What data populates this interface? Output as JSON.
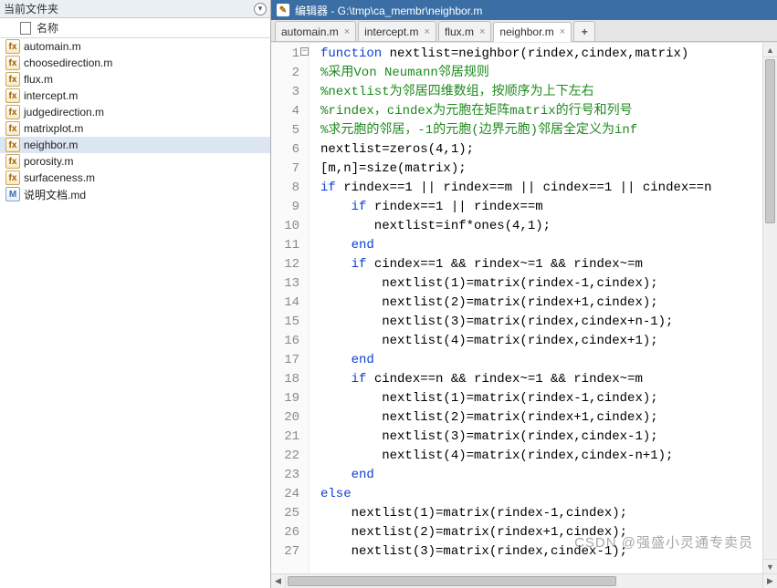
{
  "file_panel": {
    "title": "当前文件夹",
    "column_header": "名称",
    "files": [
      {
        "name": "automain.m",
        "type": "m"
      },
      {
        "name": "choosedirection.m",
        "type": "m"
      },
      {
        "name": "flux.m",
        "type": "m"
      },
      {
        "name": "intercept.m",
        "type": "m"
      },
      {
        "name": "judgedirection.m",
        "type": "m"
      },
      {
        "name": "matrixplot.m",
        "type": "m"
      },
      {
        "name": "neighbor.m",
        "type": "m",
        "selected": true
      },
      {
        "name": "porosity.m",
        "type": "m"
      },
      {
        "name": "surfaceness.m",
        "type": "m"
      },
      {
        "name": "说明文档.md",
        "type": "md"
      }
    ]
  },
  "editor": {
    "title": "编辑器 - G:\\tmp\\ca_membr\\neighbor.m",
    "tabs": [
      {
        "label": "automain.m",
        "active": false
      },
      {
        "label": "intercept.m",
        "active": false
      },
      {
        "label": "flux.m",
        "active": false
      },
      {
        "label": "neighbor.m",
        "active": true
      }
    ],
    "plus_label": "+",
    "lines": [
      {
        "n": 1,
        "fold": true,
        "spans": [
          {
            "c": "kw",
            "t": "function "
          },
          {
            "c": "fn",
            "t": "nextlist=neighbor(rindex,cindex,matrix)"
          }
        ]
      },
      {
        "n": 2,
        "spans": [
          {
            "c": "cm",
            "t": "%采用Von Neumann邻居规则"
          }
        ]
      },
      {
        "n": 3,
        "spans": [
          {
            "c": "cm",
            "t": "%nextlist为邻居四维数组，按顺序为上下左右"
          }
        ]
      },
      {
        "n": 4,
        "spans": [
          {
            "c": "cm",
            "t": "%rindex，cindex为元胞在矩阵matrix的行号和列号"
          }
        ]
      },
      {
        "n": 5,
        "spans": [
          {
            "c": "cm",
            "t": "%求元胞的邻居，-1的元胞(边界元胞)邻居全定义为inf"
          }
        ]
      },
      {
        "n": 6,
        "spans": [
          {
            "c": "fn",
            "t": "nextlist=zeros(4,1);"
          }
        ]
      },
      {
        "n": 7,
        "spans": [
          {
            "c": "fn",
            "t": "[m,n]=size(matrix);"
          }
        ]
      },
      {
        "n": 8,
        "spans": [
          {
            "c": "kw",
            "t": "if "
          },
          {
            "c": "fn",
            "t": "rindex==1 || rindex==m || cindex==1 || cindex==n"
          }
        ]
      },
      {
        "n": 9,
        "spans": [
          {
            "c": "fn",
            "t": "    "
          },
          {
            "c": "kw",
            "t": "if "
          },
          {
            "c": "fn",
            "t": "rindex==1 || rindex==m"
          }
        ]
      },
      {
        "n": 10,
        "spans": [
          {
            "c": "fn",
            "t": "       nextlist=inf*ones(4,1);"
          }
        ]
      },
      {
        "n": 11,
        "spans": [
          {
            "c": "fn",
            "t": "    "
          },
          {
            "c": "kw",
            "t": "end"
          }
        ]
      },
      {
        "n": 12,
        "spans": [
          {
            "c": "fn",
            "t": "    "
          },
          {
            "c": "kw",
            "t": "if "
          },
          {
            "c": "fn",
            "t": "cindex==1 && rindex~=1 && rindex~=m"
          }
        ]
      },
      {
        "n": 13,
        "spans": [
          {
            "c": "fn",
            "t": "        nextlist(1)=matrix(rindex-1,cindex);"
          }
        ]
      },
      {
        "n": 14,
        "spans": [
          {
            "c": "fn",
            "t": "        nextlist(2)=matrix(rindex+1,cindex);"
          }
        ]
      },
      {
        "n": 15,
        "spans": [
          {
            "c": "fn",
            "t": "        nextlist(3)=matrix(rindex,cindex+n-1);"
          }
        ]
      },
      {
        "n": 16,
        "spans": [
          {
            "c": "fn",
            "t": "        nextlist(4)=matrix(rindex,cindex+1);"
          }
        ]
      },
      {
        "n": 17,
        "spans": [
          {
            "c": "fn",
            "t": "    "
          },
          {
            "c": "kw",
            "t": "end"
          }
        ]
      },
      {
        "n": 18,
        "spans": [
          {
            "c": "fn",
            "t": "    "
          },
          {
            "c": "kw",
            "t": "if "
          },
          {
            "c": "fn",
            "t": "cindex==n && rindex~=1 && rindex~=m"
          }
        ]
      },
      {
        "n": 19,
        "spans": [
          {
            "c": "fn",
            "t": "        nextlist(1)=matrix(rindex-1,cindex);"
          }
        ]
      },
      {
        "n": 20,
        "spans": [
          {
            "c": "fn",
            "t": "        nextlist(2)=matrix(rindex+1,cindex);"
          }
        ]
      },
      {
        "n": 21,
        "spans": [
          {
            "c": "fn",
            "t": "        nextlist(3)=matrix(rindex,cindex-1);"
          }
        ]
      },
      {
        "n": 22,
        "spans": [
          {
            "c": "fn",
            "t": "        nextlist(4)=matrix(rindex,cindex-n+1);"
          }
        ]
      },
      {
        "n": 23,
        "spans": [
          {
            "c": "fn",
            "t": "    "
          },
          {
            "c": "kw",
            "t": "end"
          }
        ]
      },
      {
        "n": 24,
        "spans": [
          {
            "c": "kw",
            "t": "else"
          }
        ]
      },
      {
        "n": 25,
        "spans": [
          {
            "c": "fn",
            "t": "    nextlist(1)=matrix(rindex-1,cindex);"
          }
        ]
      },
      {
        "n": 26,
        "spans": [
          {
            "c": "fn",
            "t": "    nextlist(2)=matrix(rindex+1,cindex);"
          }
        ]
      },
      {
        "n": 27,
        "spans": [
          {
            "c": "fn",
            "t": "    nextlist(3)=matrix(rindex,cindex-1);"
          }
        ]
      }
    ]
  },
  "watermark": "CSDN @强盛小灵通专卖员"
}
